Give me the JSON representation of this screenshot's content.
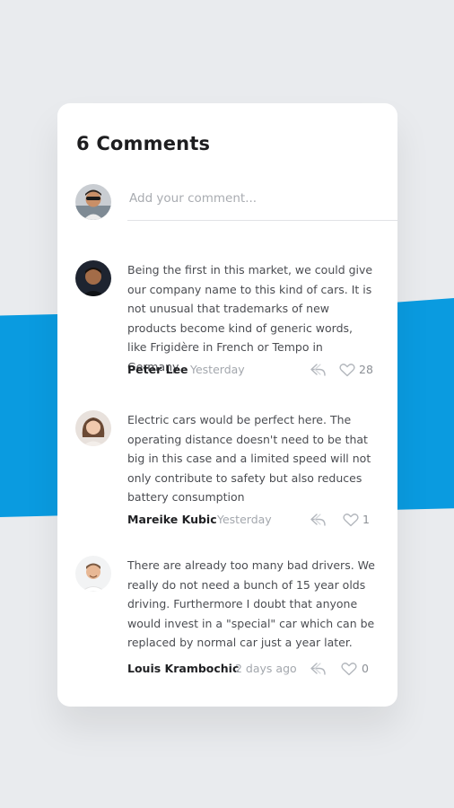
{
  "header": {
    "title": "6 Comments"
  },
  "compose": {
    "placeholder": "Add your comment..."
  },
  "comments": [
    {
      "text": "Being the first in this market, we could give our company name to this kind of cars. It is not unusual that trademarks of new products become kind of generic words, like Frigidère in French or Tempo in Germany.",
      "author": "Peter Lee",
      "time": "Yesterday",
      "likes": "28"
    },
    {
      "text": "Electric cars would be perfect here. The operating distance doesn't need to be that big in this case and a limited speed will not only contribute to safety but also reduces battery consumption",
      "author": "Mareike Kubic",
      "time": "Yesterday",
      "likes": "1"
    },
    {
      "text": "There are already too many bad drivers. We really do not need a bunch of 15 year olds driving. Furthermore I doubt that anyone would invest in a \"special\" car which can be replaced by normal car just a year later.",
      "author": "Louis Krambochic",
      "time": "2 days ago",
      "likes": "0"
    }
  ],
  "icons": {
    "reply": "reply-icon",
    "like": "heart-icon"
  },
  "colors": {
    "accent": "#0a9be0",
    "background": "#e9ebee",
    "card": "#ffffff"
  }
}
